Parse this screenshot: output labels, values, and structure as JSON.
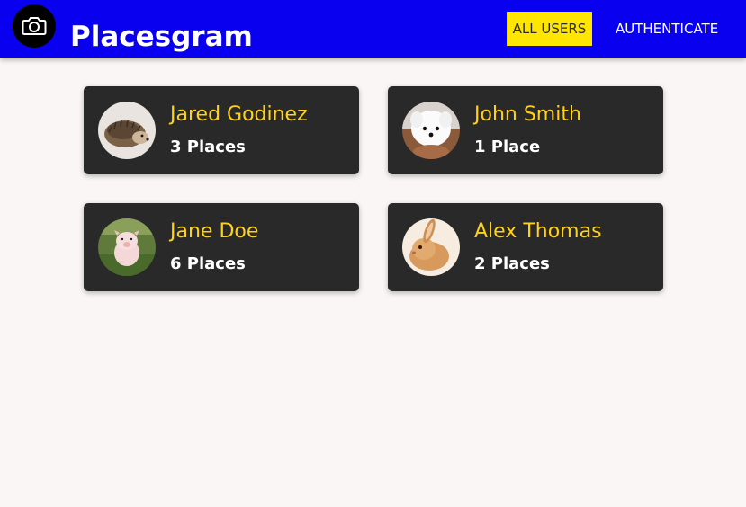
{
  "header": {
    "logo_icon": "camera-icon",
    "title": "Placesgram",
    "nav": {
      "all_users_label": "ALL USERS",
      "authenticate_label": "AUTHENTICATE"
    },
    "colors": {
      "background": "#0a00f0",
      "active_nav": "#ffe600"
    }
  },
  "users": [
    {
      "name": "Jared Godinez",
      "places": "3 Places",
      "avatar": "hedgehog"
    },
    {
      "name": "John Smith",
      "places": "1 Place",
      "avatar": "white-puppy"
    },
    {
      "name": "Jane Doe",
      "places": "6 Places",
      "avatar": "piglet"
    },
    {
      "name": "Alex Thomas",
      "places": "2 Places",
      "avatar": "bunny"
    }
  ],
  "colors": {
    "page_background": "#fbf6f6",
    "card_background": "#292929",
    "user_name": "#ffd11a",
    "place_count": "#ffffff"
  }
}
